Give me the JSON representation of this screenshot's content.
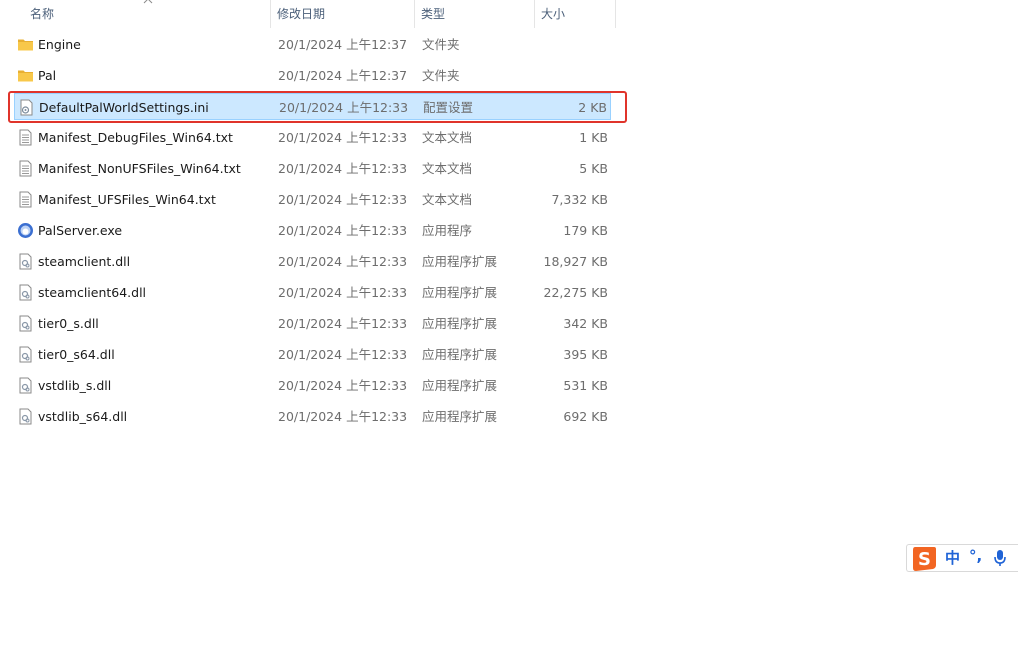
{
  "columns": {
    "name": "名称",
    "modified": "修改日期",
    "type": "类型",
    "size": "大小"
  },
  "sort_indicator": "up-chevron-icon",
  "files": [
    {
      "name": "Engine",
      "modified": "20/1/2024 上午12:37",
      "type": "文件夹",
      "size": "",
      "icon": "folder-icon"
    },
    {
      "name": "Pal",
      "modified": "20/1/2024 上午12:37",
      "type": "文件夹",
      "size": "",
      "icon": "folder-icon"
    },
    {
      "name": "DefaultPalWorldSettings.ini",
      "modified": "20/1/2024 上午12:33",
      "type": "配置设置",
      "size": "2 KB",
      "icon": "config-file-icon",
      "selected": true
    },
    {
      "name": "Manifest_DebugFiles_Win64.txt",
      "modified": "20/1/2024 上午12:33",
      "type": "文本文档",
      "size": "1 KB",
      "icon": "text-file-icon"
    },
    {
      "name": "Manifest_NonUFSFiles_Win64.txt",
      "modified": "20/1/2024 上午12:33",
      "type": "文本文档",
      "size": "5 KB",
      "icon": "text-file-icon"
    },
    {
      "name": "Manifest_UFSFiles_Win64.txt",
      "modified": "20/1/2024 上午12:33",
      "type": "文本文档",
      "size": "7,332 KB",
      "icon": "text-file-icon"
    },
    {
      "name": "PalServer.exe",
      "modified": "20/1/2024 上午12:33",
      "type": "应用程序",
      "size": "179 KB",
      "icon": "app-exe-icon"
    },
    {
      "name": "steamclient.dll",
      "modified": "20/1/2024 上午12:33",
      "type": "应用程序扩展",
      "size": "18,927 KB",
      "icon": "dll-file-icon"
    },
    {
      "name": "steamclient64.dll",
      "modified": "20/1/2024 上午12:33",
      "type": "应用程序扩展",
      "size": "22,275 KB",
      "icon": "dll-file-icon"
    },
    {
      "name": "tier0_s.dll",
      "modified": "20/1/2024 上午12:33",
      "type": "应用程序扩展",
      "size": "342 KB",
      "icon": "dll-file-icon"
    },
    {
      "name": "tier0_s64.dll",
      "modified": "20/1/2024 上午12:33",
      "type": "应用程序扩展",
      "size": "395 KB",
      "icon": "dll-file-icon"
    },
    {
      "name": "vstdlib_s.dll",
      "modified": "20/1/2024 上午12:33",
      "type": "应用程序扩展",
      "size": "531 KB",
      "icon": "dll-file-icon"
    },
    {
      "name": "vstdlib_s64.dll",
      "modified": "20/1/2024 上午12:33",
      "type": "应用程序扩展",
      "size": "692 KB",
      "icon": "dll-file-icon"
    }
  ],
  "ime": {
    "mode": "中",
    "punct": "°,",
    "logo_icon": "sogou-s-icon",
    "mic_icon": "microphone-icon"
  },
  "colors": {
    "selection_bg": "#cce8ff",
    "selection_border": "#99d1ff",
    "highlight_box": "#e0342b",
    "folder": "#f8c84a",
    "ime_logo": "#f26522",
    "ime_accent": "#1f63d6"
  }
}
